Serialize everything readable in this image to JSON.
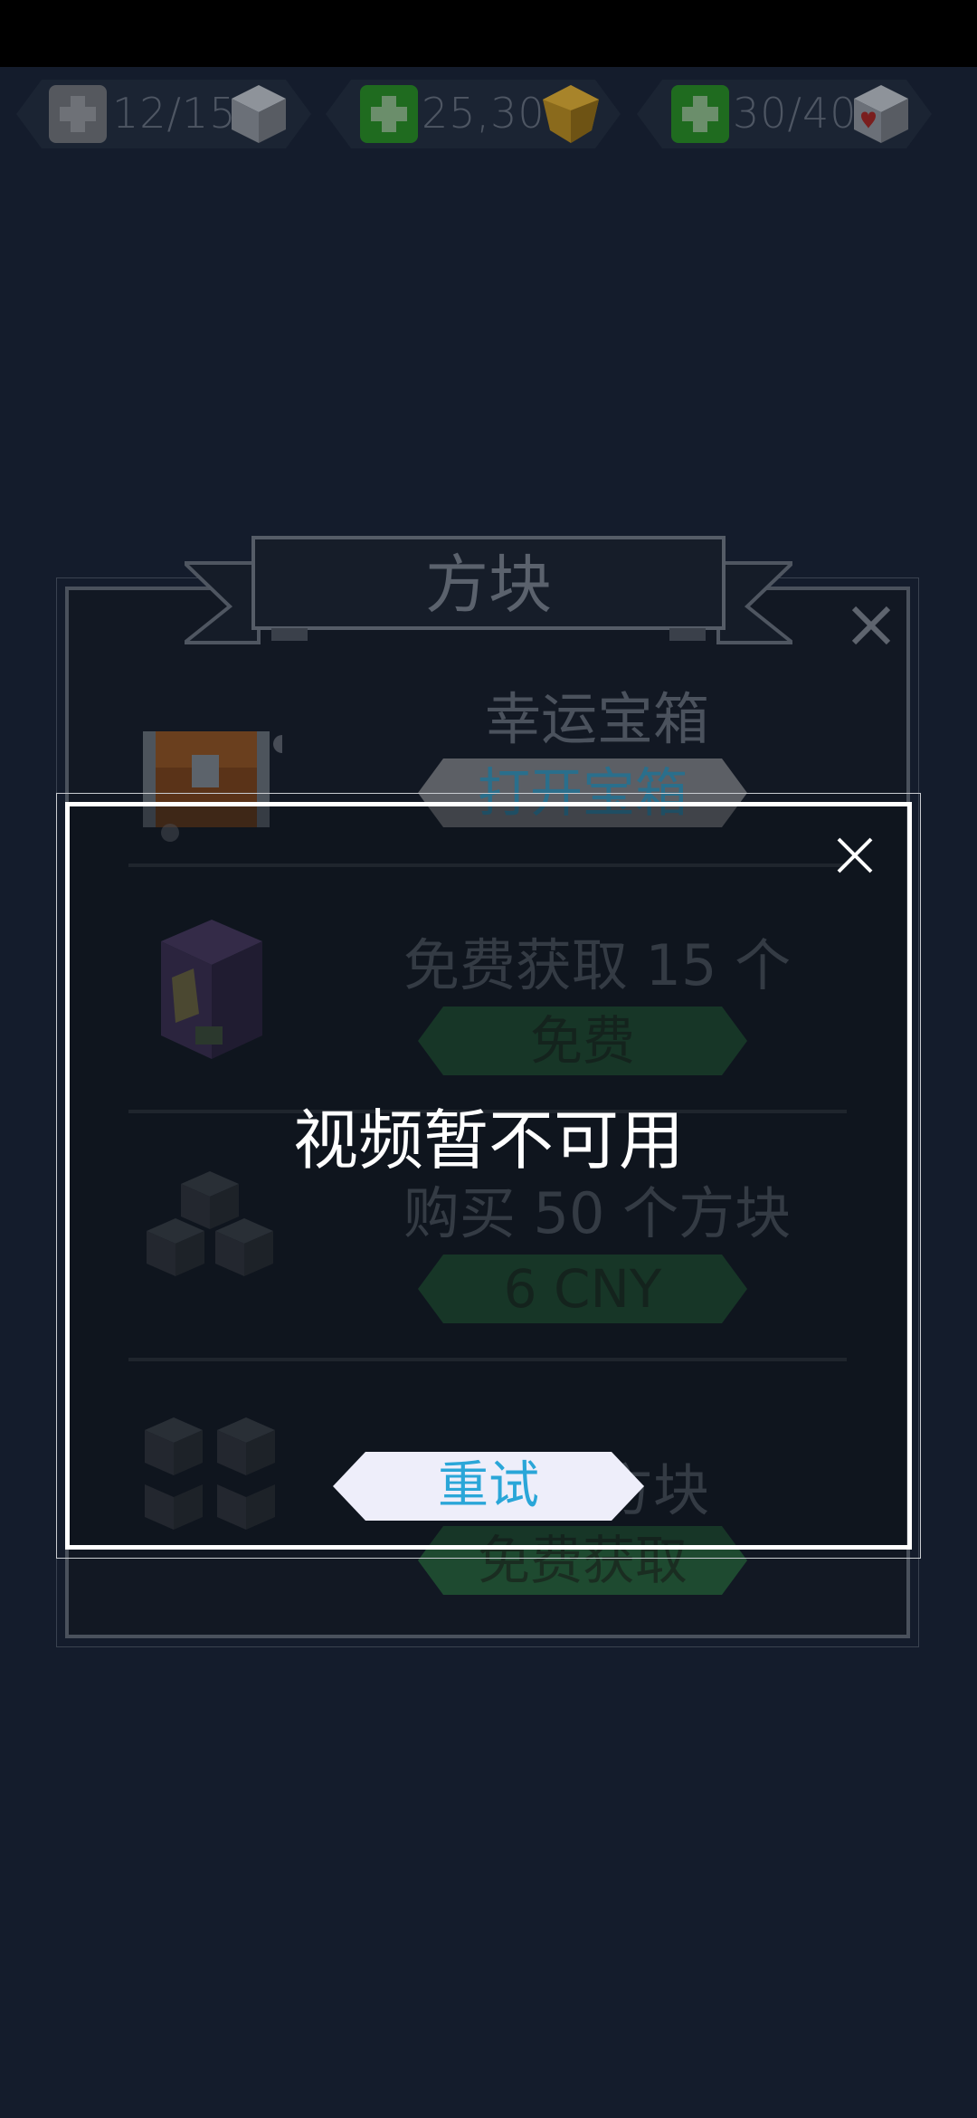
{
  "resources": [
    {
      "value": "12/15",
      "plus_color": "#5a5d63",
      "icon": "white-cube-icon"
    },
    {
      "value": "25,305",
      "plus_color": "#1f7a1f",
      "icon": "gold-gem-icon"
    },
    {
      "value": "30/40",
      "plus_color": "#1f7a1f",
      "icon": "heart-cube-icon"
    }
  ],
  "store": {
    "title": "方块",
    "items": [
      {
        "title": "幸运宝箱",
        "button": "打开宝箱",
        "icon": "treasure-chest-icon"
      },
      {
        "title": "免费获取 15 个",
        "button": "免费",
        "icon": "ad-cube-icon"
      },
      {
        "title": "购买 50 个方块",
        "button": "6 CNY",
        "icon": "cube-stack-icon"
      },
      {
        "title": "无限方块",
        "button": "免费获取",
        "icon": "cube-grid-icon"
      }
    ]
  },
  "modal": {
    "message": "视频暂不可用",
    "retry_label": "重试"
  },
  "colors": {
    "background": "#141c2c",
    "gray_button": "#5a5d63",
    "green_button": "#1e4a30",
    "retry_text": "#2aa6d8"
  }
}
